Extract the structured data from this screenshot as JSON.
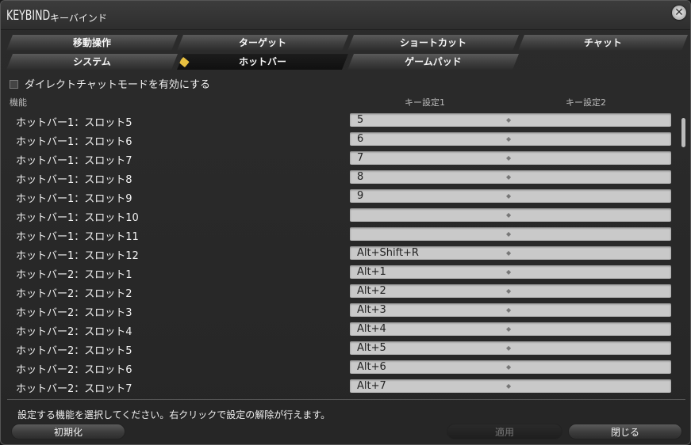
{
  "window": {
    "title_main": "KEYBIND",
    "title_sub": "キーバインド"
  },
  "tabs_row1": [
    {
      "label": "移動操作"
    },
    {
      "label": "ターゲット"
    },
    {
      "label": "ショートカット"
    },
    {
      "label": "チャット"
    }
  ],
  "tabs_row2": [
    {
      "label": "システム"
    },
    {
      "label": "ホットバー",
      "active": true
    },
    {
      "label": "ゲームパッド"
    }
  ],
  "direct_chat": {
    "label": "ダイレクトチャットモードを有効にする",
    "checked": false
  },
  "headers": {
    "function": "機能",
    "key1": "キー設定1",
    "key2": "キー設定2"
  },
  "rows": [
    {
      "fn": "ホットバー1：スロット5",
      "key1": "5"
    },
    {
      "fn": "ホットバー1：スロット6",
      "key1": "6"
    },
    {
      "fn": "ホットバー1：スロット7",
      "key1": "7"
    },
    {
      "fn": "ホットバー1：スロット8",
      "key1": "8"
    },
    {
      "fn": "ホットバー1：スロット9",
      "key1": "9"
    },
    {
      "fn": "ホットバー1：スロット10",
      "key1": ""
    },
    {
      "fn": "ホットバー1：スロット11",
      "key1": ""
    },
    {
      "fn": "ホットバー1：スロット12",
      "key1": "Alt+Shift+R"
    },
    {
      "fn": "ホットバー2：スロット1",
      "key1": "Alt+1"
    },
    {
      "fn": "ホットバー2：スロット2",
      "key1": "Alt+2"
    },
    {
      "fn": "ホットバー2：スロット3",
      "key1": "Alt+3"
    },
    {
      "fn": "ホットバー2：スロット4",
      "key1": "Alt+4"
    },
    {
      "fn": "ホットバー2：スロット5",
      "key1": "Alt+5"
    },
    {
      "fn": "ホットバー2：スロット6",
      "key1": "Alt+6"
    },
    {
      "fn": "ホットバー2：スロット7",
      "key1": "Alt+7"
    }
  ],
  "key_separator": "◆",
  "help_text": "設定する機能を選択してください。右クリックで設定の解除が行えます。",
  "buttons": {
    "reset": "初期化",
    "apply": "適用",
    "close": "閉じる"
  }
}
